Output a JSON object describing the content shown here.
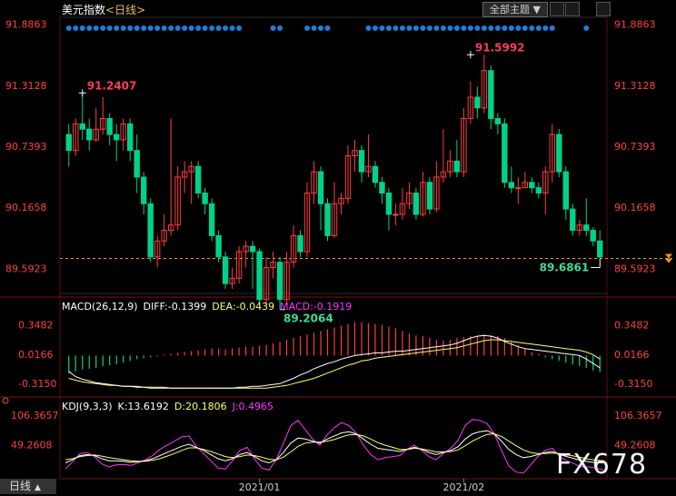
{
  "header": {
    "title": "美元指数",
    "period": "<日线>",
    "theme_button": "全部主题"
  },
  "macd_header": {
    "name": "MACD(26,12,9)",
    "diff": "DIFF:-0.1399",
    "dea": "DEA:-0.0439",
    "macd": "MACD:-0.1919"
  },
  "kdj_header": {
    "name": "KDJ(9,3,3)",
    "k": "K:13.6192",
    "d": "D:20.1806",
    "j": "J:0.4965"
  },
  "bottom_tab": "日线",
  "watermark": "FX678",
  "colors": {
    "up": "#ff3d3d",
    "down": "#00d28a",
    "diff": "#ffffff",
    "dea": "#ffff66",
    "macd": "#ff33ff",
    "axis_text": "#ff4040",
    "dot": "#1e7fd8"
  },
  "chart_data": [
    {
      "type": "candlestick",
      "title": "美元指数",
      "y_ticks": [
        "91.8863",
        "91.3128",
        "90.7393",
        "90.1658",
        "89.5923"
      ],
      "ylim": [
        89.4,
        91.9
      ],
      "x_ticks": [
        {
          "index": 28,
          "label": "2021/01"
        },
        {
          "index": 58,
          "label": "2021/02"
        }
      ],
      "last_price": 89.6861,
      "annotations": [
        {
          "label": "91.2407",
          "index": 2,
          "value": 91.2407
        },
        {
          "label": "91.5992",
          "index": 59,
          "value": 91.5992
        },
        {
          "label": "89.2064",
          "index": 31,
          "value": 89.2064
        },
        {
          "label": "89.6861",
          "index": 78,
          "value": 89.6861
        }
      ],
      "candles": [
        [
          90.85,
          90.7,
          90.95,
          90.55
        ],
        [
          90.7,
          90.95,
          91.0,
          90.65
        ],
        [
          90.95,
          90.9,
          91.24,
          90.8
        ],
        [
          90.9,
          90.8,
          91.0,
          90.7
        ],
        [
          90.8,
          90.9,
          91.1,
          90.78
        ],
        [
          90.9,
          91.0,
          91.2,
          90.85
        ],
        [
          91.0,
          90.85,
          91.05,
          90.75
        ],
        [
          90.85,
          90.8,
          90.95,
          90.6
        ],
        [
          90.8,
          90.95,
          91.0,
          90.7
        ],
        [
          90.95,
          90.7,
          91.0,
          90.6
        ],
        [
          90.7,
          90.45,
          90.85,
          90.3
        ],
        [
          90.45,
          90.2,
          90.5,
          90.1
        ],
        [
          90.2,
          89.7,
          90.25,
          89.65
        ],
        [
          89.7,
          89.85,
          89.9,
          89.6
        ],
        [
          89.85,
          89.95,
          90.1,
          89.8
        ],
        [
          89.95,
          90.0,
          91.0,
          89.9
        ],
        [
          90.0,
          90.45,
          90.55,
          89.95
        ],
        [
          90.45,
          90.5,
          90.6,
          90.3
        ],
        [
          90.5,
          90.55,
          90.6,
          90.2
        ],
        [
          90.55,
          90.3,
          90.6,
          90.25
        ],
        [
          90.3,
          90.2,
          90.35,
          90.1
        ],
        [
          90.2,
          89.9,
          90.25,
          89.85
        ],
        [
          89.9,
          89.7,
          89.95,
          89.65
        ],
        [
          89.7,
          89.45,
          89.75,
          89.4
        ],
        [
          89.45,
          89.5,
          89.6,
          89.4
        ],
        [
          89.5,
          89.75,
          89.8,
          89.45
        ],
        [
          89.75,
          89.8,
          89.85,
          89.6
        ],
        [
          89.8,
          89.75,
          89.85,
          89.4
        ],
        [
          89.75,
          89.3,
          89.78,
          89.25
        ],
        [
          89.3,
          89.6,
          89.7,
          89.25
        ],
        [
          89.6,
          89.65,
          89.75,
          89.5
        ],
        [
          89.65,
          89.3,
          89.7,
          89.21
        ],
        [
          89.3,
          89.65,
          89.75,
          89.25
        ],
        [
          89.65,
          89.9,
          90.0,
          89.6
        ],
        [
          89.9,
          89.75,
          89.95,
          89.7
        ],
        [
          89.75,
          90.3,
          90.4,
          89.7
        ],
        [
          90.3,
          90.5,
          90.6,
          90.2
        ],
        [
          90.5,
          90.2,
          90.55,
          89.95
        ],
        [
          90.2,
          89.9,
          90.25,
          89.85
        ],
        [
          89.9,
          90.2,
          90.4,
          89.88
        ],
        [
          90.2,
          90.25,
          90.3,
          90.1
        ],
        [
          90.25,
          90.65,
          90.75,
          90.2
        ],
        [
          90.65,
          90.7,
          90.8,
          90.5
        ],
        [
          90.7,
          90.5,
          90.75,
          90.4
        ],
        [
          90.5,
          90.55,
          90.85,
          90.45
        ],
        [
          90.55,
          90.4,
          90.6,
          90.35
        ],
        [
          90.4,
          90.3,
          90.45,
          90.2
        ],
        [
          90.3,
          90.1,
          90.35,
          89.95
        ],
        [
          90.1,
          90.1,
          90.2,
          90.0
        ],
        [
          90.1,
          90.2,
          90.35,
          90.05
        ],
        [
          90.2,
          90.3,
          90.4,
          90.15
        ],
        [
          90.3,
          90.1,
          90.35,
          90.05
        ],
        [
          90.1,
          90.4,
          90.5,
          90.08
        ],
        [
          90.4,
          90.15,
          90.45,
          90.1
        ],
        [
          90.15,
          90.45,
          90.6,
          90.12
        ],
        [
          90.45,
          90.5,
          90.9,
          90.4
        ],
        [
          90.5,
          90.6,
          90.7,
          90.45
        ],
        [
          90.6,
          90.5,
          90.8,
          90.45
        ],
        [
          90.5,
          91.0,
          91.1,
          90.45
        ],
        [
          91.0,
          91.2,
          91.35,
          90.95
        ],
        [
          91.2,
          91.1,
          91.3,
          91.0
        ],
        [
          91.1,
          91.45,
          91.6,
          91.05
        ],
        [
          91.45,
          91.0,
          91.5,
          90.9
        ],
        [
          91.0,
          90.95,
          91.05,
          90.85
        ],
        [
          90.95,
          90.4,
          91.0,
          90.35
        ],
        [
          90.4,
          90.35,
          90.55,
          90.3
        ],
        [
          90.35,
          90.35,
          90.45,
          90.2
        ],
        [
          90.35,
          90.4,
          90.5,
          90.35
        ],
        [
          90.4,
          90.35,
          90.45,
          90.3
        ],
        [
          90.35,
          90.3,
          90.4,
          90.25
        ],
        [
          90.3,
          90.5,
          90.55,
          90.1
        ],
        [
          90.5,
          90.85,
          90.95,
          90.4
        ],
        [
          90.85,
          90.5,
          90.9,
          90.45
        ],
        [
          90.5,
          90.15,
          90.55,
          90.05
        ],
        [
          90.15,
          89.95,
          90.2,
          89.9
        ],
        [
          89.95,
          90.0,
          90.05,
          89.9
        ],
        [
          90.0,
          89.95,
          90.25,
          89.9
        ],
        [
          89.95,
          89.85,
          89.98,
          89.8
        ],
        [
          89.85,
          89.7,
          89.95,
          89.69
        ]
      ]
    },
    {
      "type": "bar+line",
      "title": "MACD(26,12,9)",
      "y_ticks": [
        "0.3482",
        "0.0166",
        "-0.3150"
      ],
      "ylim": [
        -0.42,
        0.48
      ],
      "macd_hist": [
        -0.2,
        -0.18,
        -0.16,
        -0.15,
        -0.14,
        -0.12,
        -0.11,
        -0.1,
        -0.08,
        -0.06,
        -0.04,
        -0.03,
        -0.02,
        -0.01,
        0.01,
        0.02,
        0.03,
        0.04,
        0.05,
        0.06,
        0.07,
        0.08,
        0.08,
        0.07,
        0.08,
        0.09,
        0.1,
        0.1,
        0.11,
        0.12,
        0.14,
        0.16,
        0.18,
        0.2,
        0.22,
        0.24,
        0.26,
        0.28,
        0.3,
        0.32,
        0.34,
        0.36,
        0.38,
        0.38,
        0.37,
        0.36,
        0.35,
        0.33,
        0.31,
        0.28,
        0.25,
        0.23,
        0.22,
        0.2,
        0.18,
        0.17,
        0.18,
        0.2,
        0.21,
        0.22,
        0.23,
        0.24,
        0.23,
        0.22,
        0.2,
        0.16,
        0.12,
        0.08,
        0.04,
        0.02,
        -0.02,
        -0.04,
        -0.06,
        -0.08,
        -0.1,
        -0.12,
        -0.14,
        -0.17,
        -0.19
      ],
      "diff": [
        -0.18,
        -0.24,
        -0.27,
        -0.29,
        -0.31,
        -0.32,
        -0.33,
        -0.34,
        -0.35,
        -0.35,
        -0.36,
        -0.36,
        -0.37,
        -0.37,
        -0.37,
        -0.37,
        -0.37,
        -0.37,
        -0.37,
        -0.37,
        -0.37,
        -0.37,
        -0.37,
        -0.37,
        -0.37,
        -0.36,
        -0.36,
        -0.35,
        -0.35,
        -0.34,
        -0.33,
        -0.32,
        -0.29,
        -0.26,
        -0.22,
        -0.19,
        -0.15,
        -0.12,
        -0.09,
        -0.07,
        -0.04,
        -0.02,
        0.0,
        0.01,
        0.02,
        0.03,
        0.03,
        0.04,
        0.05,
        0.05,
        0.06,
        0.07,
        0.08,
        0.09,
        0.1,
        0.11,
        0.12,
        0.14,
        0.17,
        0.2,
        0.22,
        0.23,
        0.22,
        0.2,
        0.16,
        0.13,
        0.1,
        0.08,
        0.07,
        0.06,
        0.05,
        0.04,
        0.03,
        0.02,
        0.01,
        0.0,
        -0.04,
        -0.09,
        -0.14
      ],
      "dea": [
        -0.26,
        -0.28,
        -0.3,
        -0.31,
        -0.32,
        -0.33,
        -0.34,
        -0.34,
        -0.35,
        -0.35,
        -0.35,
        -0.36,
        -0.36,
        -0.36,
        -0.36,
        -0.37,
        -0.37,
        -0.37,
        -0.37,
        -0.37,
        -0.37,
        -0.37,
        -0.37,
        -0.37,
        -0.37,
        -0.37,
        -0.37,
        -0.37,
        -0.37,
        -0.37,
        -0.36,
        -0.35,
        -0.34,
        -0.32,
        -0.3,
        -0.28,
        -0.26,
        -0.23,
        -0.2,
        -0.17,
        -0.14,
        -0.11,
        -0.09,
        -0.06,
        -0.05,
        -0.03,
        -0.02,
        -0.01,
        0.0,
        0.01,
        0.02,
        0.03,
        0.04,
        0.05,
        0.06,
        0.07,
        0.08,
        0.09,
        0.11,
        0.13,
        0.15,
        0.17,
        0.18,
        0.18,
        0.17,
        0.16,
        0.15,
        0.14,
        0.13,
        0.12,
        0.11,
        0.1,
        0.09,
        0.08,
        0.07,
        0.06,
        0.04,
        0.01,
        -0.04
      ]
    },
    {
      "type": "line",
      "title": "KDJ(9,3,3)",
      "y_ticks": [
        "106.3657",
        "49.2608"
      ],
      "ylim": [
        -8,
        122
      ],
      "x_ticks": [
        {
          "index": 28,
          "label": "2021/01"
        },
        {
          "index": 58,
          "label": "2021/02"
        }
      ],
      "k": [
        14,
        20,
        28,
        30,
        28,
        22,
        18,
        18,
        17,
        15,
        16,
        18,
        22,
        28,
        34,
        40,
        46,
        50,
        44,
        38,
        30,
        22,
        18,
        22,
        30,
        34,
        26,
        18,
        14,
        20,
        34,
        52,
        62,
        60,
        56,
        52,
        60,
        66,
        72,
        74,
        70,
        60,
        50,
        42,
        40,
        38,
        36,
        40,
        44,
        40,
        34,
        30,
        34,
        38,
        45,
        60,
        70,
        74,
        76,
        70,
        56,
        40,
        30,
        24,
        26,
        30,
        34,
        36,
        30,
        26,
        22,
        18,
        16,
        14,
        14
      ],
      "d": [
        20,
        22,
        26,
        28,
        29,
        27,
        24,
        22,
        20,
        18,
        17,
        17,
        19,
        22,
        27,
        32,
        38,
        43,
        43,
        40,
        36,
        31,
        26,
        24,
        26,
        29,
        28,
        25,
        21,
        20,
        25,
        35,
        46,
        52,
        54,
        54,
        56,
        59,
        64,
        68,
        69,
        66,
        60,
        53,
        48,
        44,
        40,
        40,
        42,
        41,
        38,
        35,
        35,
        36,
        39,
        47,
        56,
        63,
        69,
        70,
        65,
        56,
        47,
        39,
        34,
        32,
        32,
        33,
        32,
        30,
        27,
        24,
        21,
        19,
        18
      ],
      "j": [
        2,
        16,
        32,
        34,
        26,
        12,
        6,
        10,
        11,
        9,
        14,
        20,
        28,
        40,
        48,
        56,
        64,
        66,
        46,
        32,
        18,
        4,
        2,
        18,
        38,
        44,
        22,
        4,
        0,
        20,
        52,
        86,
        96,
        78,
        60,
        48,
        68,
        82,
        92,
        86,
        72,
        48,
        30,
        20,
        24,
        26,
        28,
        40,
        48,
        38,
        26,
        20,
        32,
        42,
        57,
        86,
        98,
        96,
        90,
        70,
        38,
        8,
        -4,
        -6,
        10,
        26,
        38,
        42,
        26,
        18,
        12,
        6,
        6,
        4,
        0
      ]
    }
  ]
}
